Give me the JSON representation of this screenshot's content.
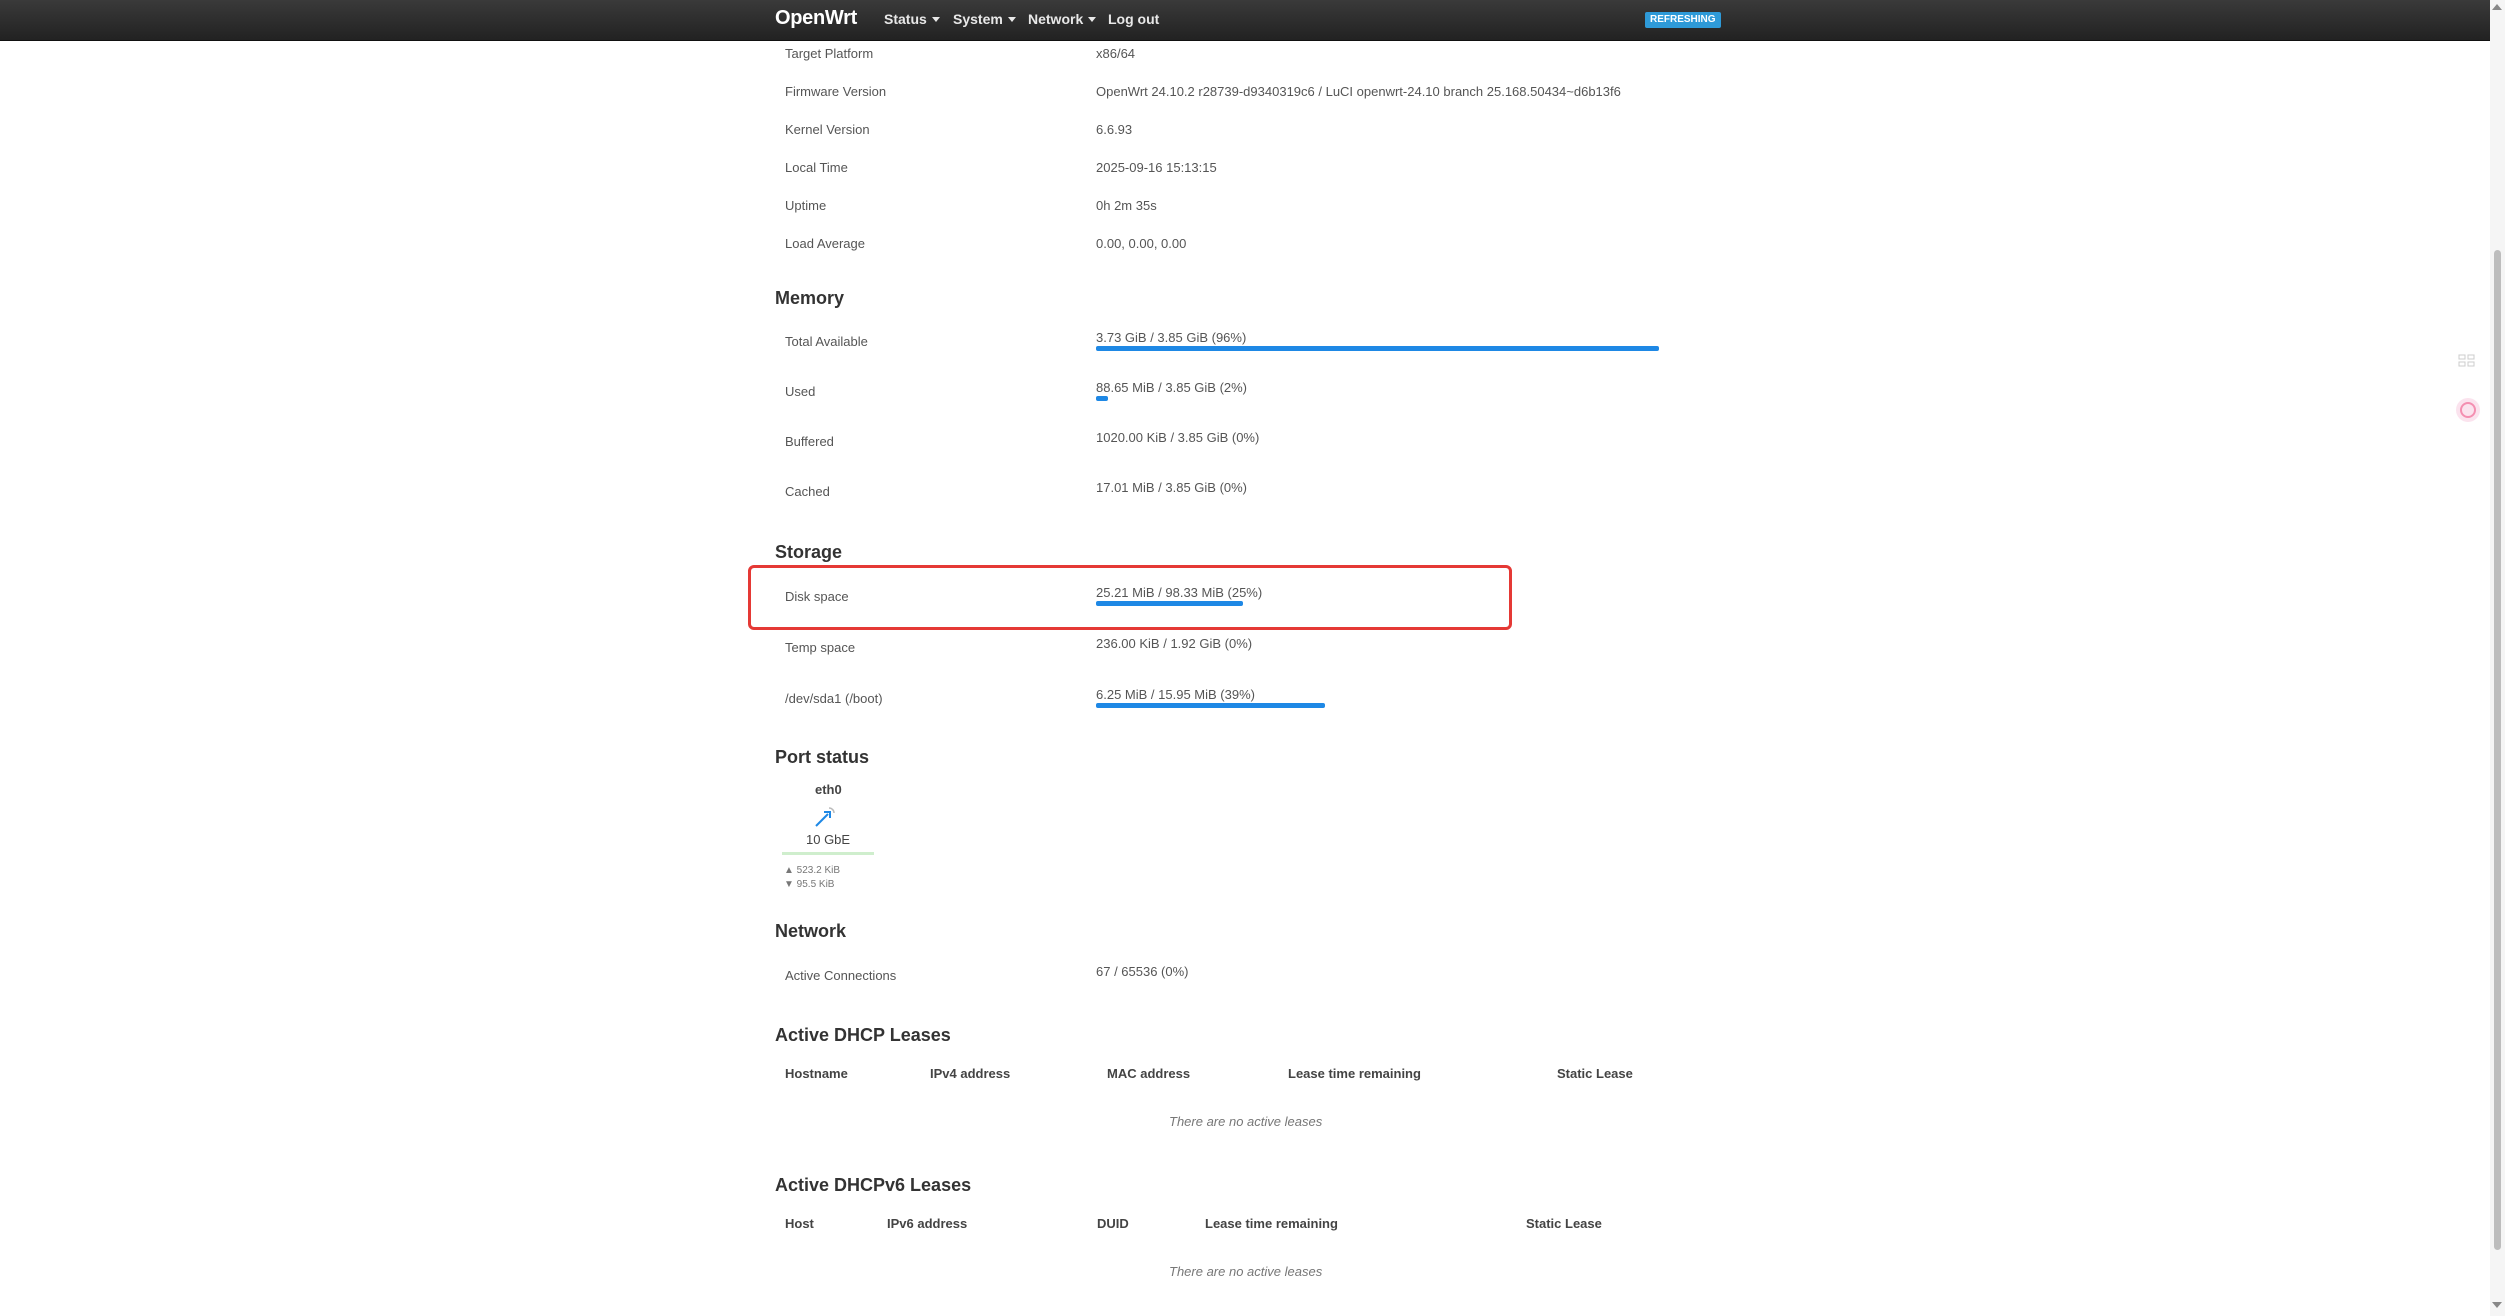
{
  "brand": "OpenWrt",
  "nav": {
    "status": "Status",
    "system": "System",
    "network": "Network",
    "logout": "Log out"
  },
  "badge": "REFRESHING",
  "system_info": [
    {
      "label": "Target Platform",
      "value": "x86/64"
    },
    {
      "label": "Firmware Version",
      "value": "OpenWrt 24.10.2 r28739-d9340319c6 / LuCI openwrt-24.10 branch 25.168.50434~d6b13f6"
    },
    {
      "label": "Kernel Version",
      "value": "6.6.93"
    },
    {
      "label": "Local Time",
      "value": "2025-09-16 15:13:15"
    },
    {
      "label": "Uptime",
      "value": "0h 2m 35s"
    },
    {
      "label": "Load Average",
      "value": "0.00, 0.00, 0.00"
    }
  ],
  "memory": {
    "title": "Memory",
    "rows": [
      {
        "label": "Total Available",
        "value": "3.73 GiB / 3.85 GiB (96%)",
        "percent": 96
      },
      {
        "label": "Used",
        "value": "88.65 MiB / 3.85 GiB (2%)",
        "percent": 2
      },
      {
        "label": "Buffered",
        "value": "1020.00 KiB / 3.85 GiB (0%)",
        "percent": 0
      },
      {
        "label": "Cached",
        "value": "17.01 MiB / 3.85 GiB (0%)",
        "percent": 0
      }
    ]
  },
  "storage": {
    "title": "Storage",
    "rows": [
      {
        "label": "Disk space",
        "value": "25.21 MiB / 98.33 MiB (25%)",
        "percent": 25
      },
      {
        "label": "Temp space",
        "value": "236.00 KiB / 1.92 GiB (0%)",
        "percent": 0
      },
      {
        "label": "/dev/sda1 (/boot)",
        "value": "6.25 MiB / 15.95 MiB (39%)",
        "percent": 39
      }
    ]
  },
  "port_status": {
    "title": "Port status",
    "name": "eth0",
    "speed": "10 GbE",
    "tx": "▲ 523.2 KiB",
    "rx": "▼ 95.5 KiB"
  },
  "network": {
    "title": "Network",
    "label": "Active Connections",
    "value": "67 / 65536 (0%)"
  },
  "dhcp": {
    "title": "Active DHCP Leases",
    "headers": [
      "Hostname",
      "IPv4 address",
      "MAC address",
      "Lease time remaining",
      "Static Lease"
    ],
    "empty": "There are no active leases"
  },
  "dhcpv6": {
    "title": "Active DHCPv6 Leases",
    "headers": [
      "Host",
      "IPv6 address",
      "DUID",
      "Lease time remaining",
      "Static Lease"
    ],
    "empty": "There are no active leases"
  },
  "colors": {
    "accent": "#1e88e5",
    "highlight": "#e53935",
    "topbar": "#2b2b2b"
  }
}
